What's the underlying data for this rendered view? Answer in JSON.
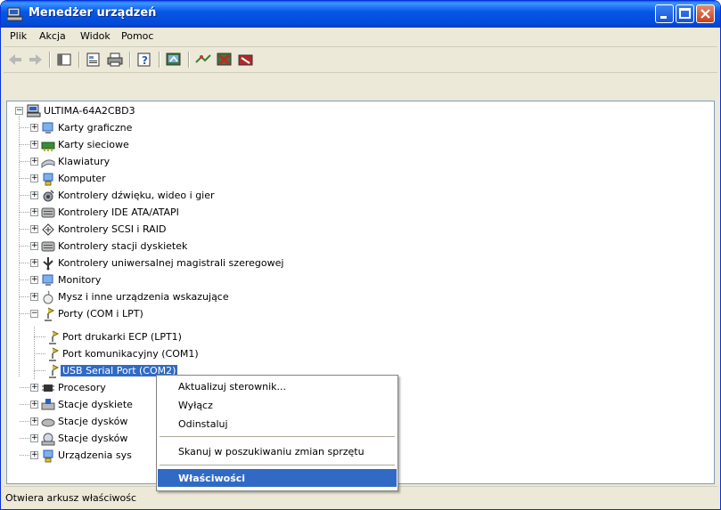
{
  "window": {
    "title": "Menedżer urządzeń"
  },
  "menu": [
    "Plik",
    "Akcja",
    "Widok",
    "Pomoc"
  ],
  "toolbar_icons": [
    "back-icon",
    "forward-icon",
    "show-hide-console-tree-icon",
    "properties-icon",
    "print-icon",
    "help-icon",
    "update-driver-icon",
    "scan-hardware-icon",
    "uninstall-icon",
    "disable-icon"
  ],
  "tree": {
    "root": "ULTIMA-64A2CBD3",
    "categories": [
      "Karty graficzne",
      "Karty sieciowe",
      "Klawiatury",
      "Komputer",
      "Kontrolery dźwięku, wideo i gier",
      "Kontrolery IDE ATA/ATAPI",
      "Kontrolery SCSI i RAID",
      "Kontrolery stacji dyskietek",
      "Kontrolery uniwersalnej magistrali szeregowej",
      "Monitory",
      "Mysz i inne urządzenia wskazujące",
      "Porty (COM i LPT)"
    ],
    "ports": [
      "Port drukarki ECP (LPT1)",
      "Port komunikacyjny (COM1)",
      "USB Serial Port (COM2)"
    ],
    "after": [
      "Procesory",
      "Stacje dyskiete",
      "Stacje dysków",
      "Stacje dysków",
      "Urządzenia sys"
    ]
  },
  "context_menu": {
    "items": [
      "Aktualizuj sterownik...",
      "Wyłącz",
      "Odinstaluj",
      "Skanuj w poszukiwaniu zmian sprzętu",
      "Właściwości"
    ]
  },
  "status": "Otwiera arkusz właściwośc"
}
